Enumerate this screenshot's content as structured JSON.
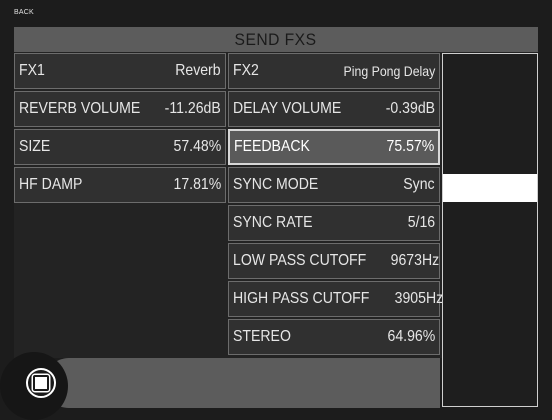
{
  "header": {
    "back_label": "BACK",
    "title": "SEND FXS"
  },
  "fx1": {
    "rows": [
      {
        "label": "FX1",
        "value": "Reverb"
      },
      {
        "label": "REVERB VOLUME",
        "value": "-11.26dB"
      },
      {
        "label": "SIZE",
        "value": "57.48%"
      },
      {
        "label": "HF DAMP",
        "value": "17.81%"
      }
    ]
  },
  "fx2": {
    "rows": [
      {
        "label": "FX2",
        "value": "Ping Pong Delay"
      },
      {
        "label": "DELAY VOLUME",
        "value": "-0.39dB"
      },
      {
        "label": "FEEDBACK",
        "value": "75.57%"
      },
      {
        "label": "SYNC MODE",
        "value": "Sync"
      },
      {
        "label": "SYNC RATE",
        "value": "5/16"
      },
      {
        "label": "LOW PASS CUTOFF",
        "value": "9673Hz"
      },
      {
        "label": "HIGH PASS CUTOFF",
        "value": "3905Hz"
      },
      {
        "label": "STEREO",
        "value": "64.96%"
      }
    ],
    "selected_index": 2
  },
  "controls": {
    "stop_icon": "stop-icon"
  },
  "colors": {
    "background": "#1c1c1c",
    "header": "#5c5c5c",
    "row": "#303030",
    "selected_row": "#5a5a5a"
  }
}
